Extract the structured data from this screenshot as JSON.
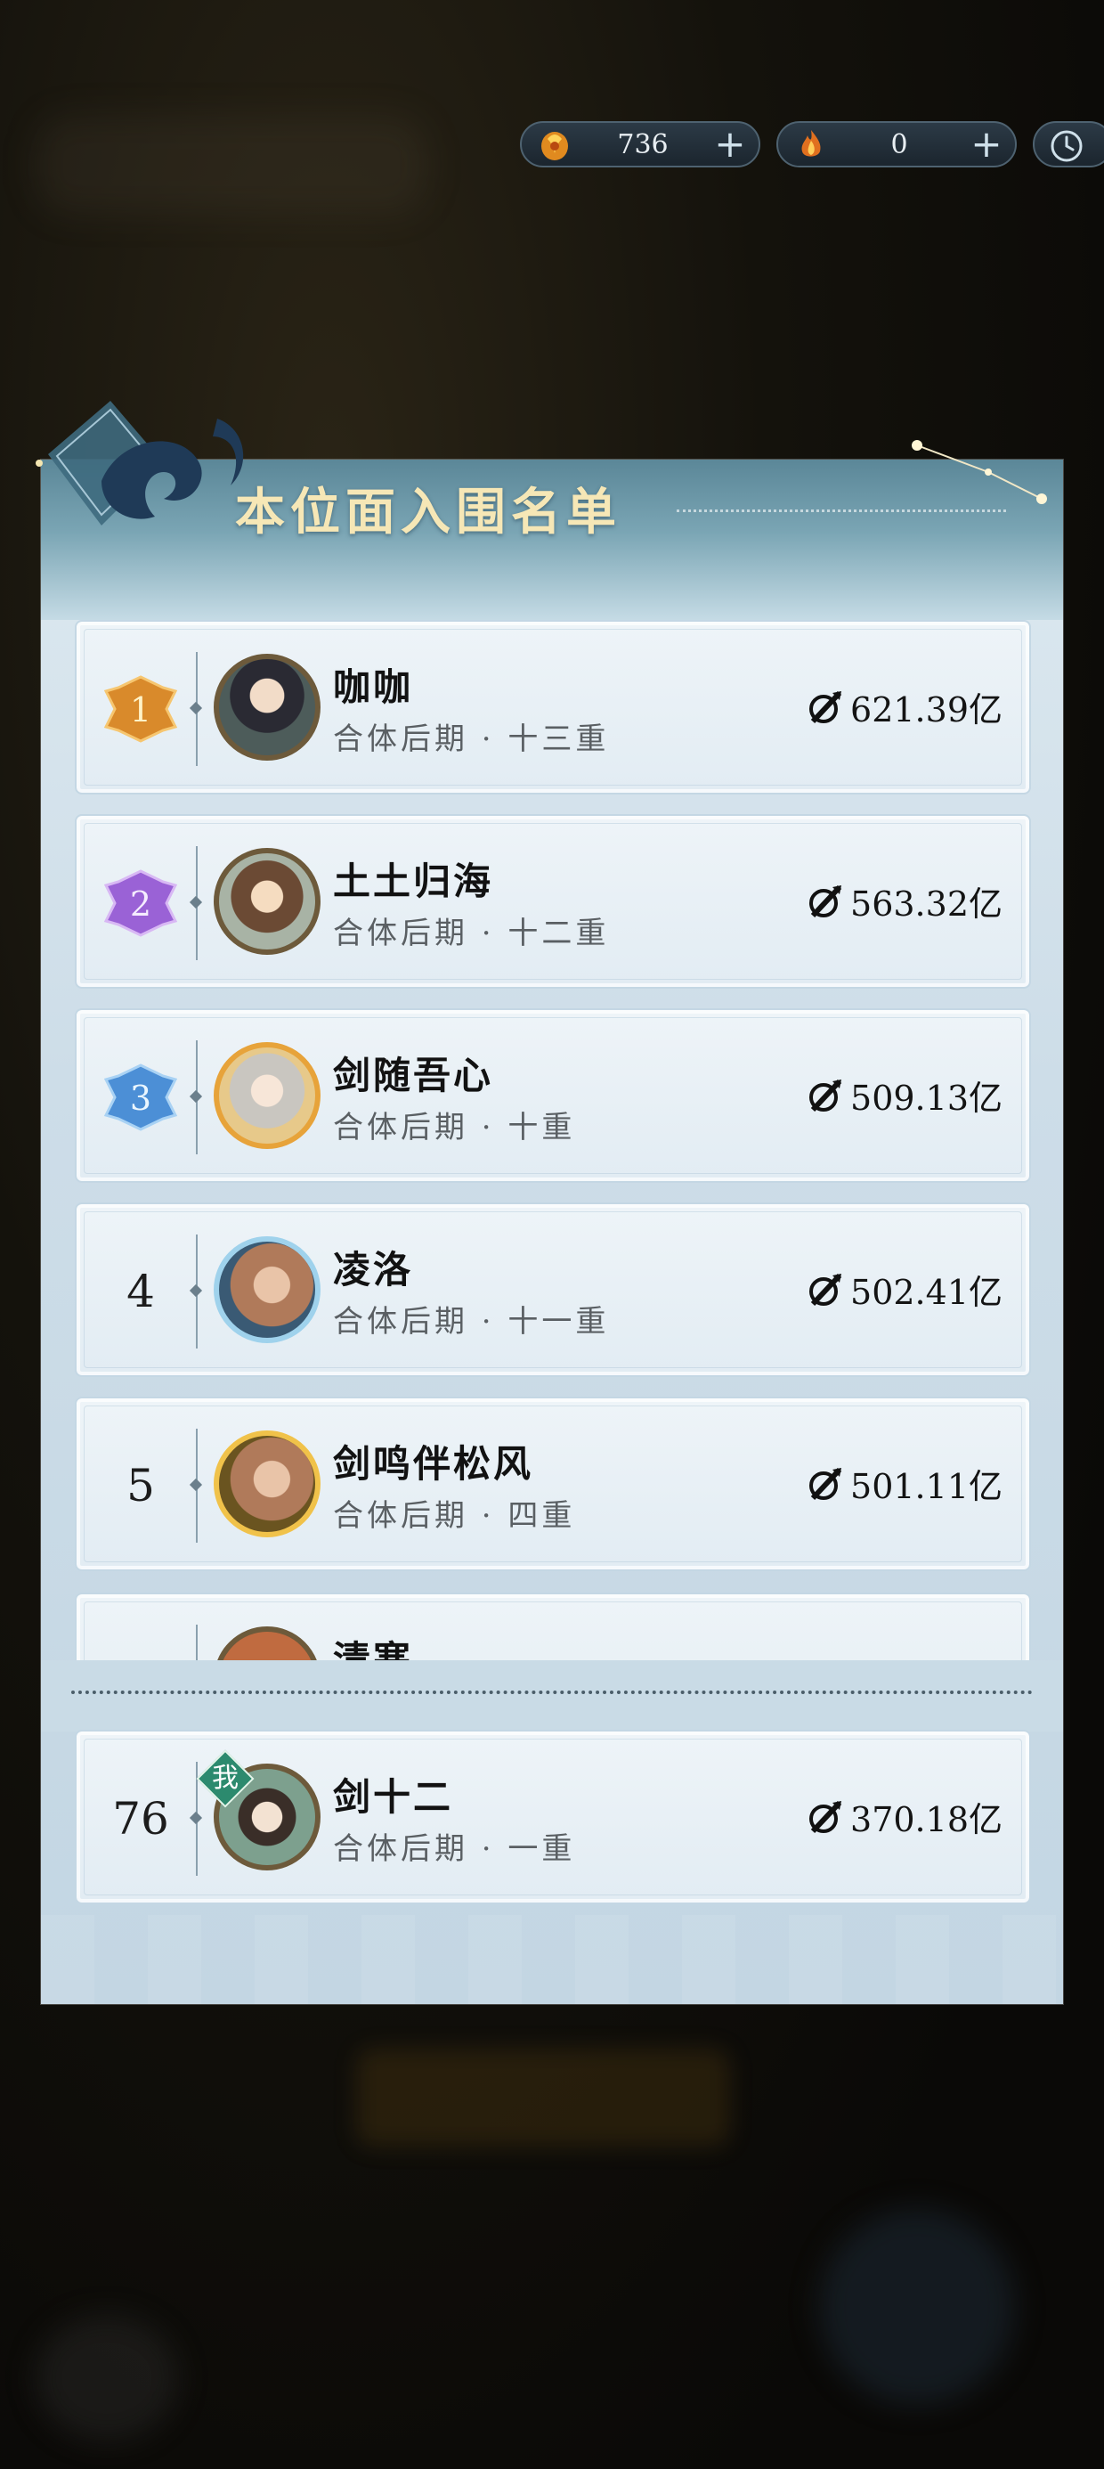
{
  "currency": [
    {
      "icon": "spirit-stone-icon",
      "value": "736"
    },
    {
      "icon": "flame-token-icon",
      "value": "0"
    }
  ],
  "panel": {
    "title": "本位面入围名单"
  },
  "rankings": [
    {
      "rank": "1",
      "name": "咖咖",
      "realm": "合体后期 · 十三重",
      "power": "621.39亿",
      "badge_color": "#d98a2b",
      "frame": "#6d5a3b"
    },
    {
      "rank": "2",
      "name": "土土归海",
      "realm": "合体后期 · 十二重",
      "power": "563.32亿",
      "badge_color": "#9a62d6",
      "frame": "#6d5a3b"
    },
    {
      "rank": "3",
      "name": "剑随吾心",
      "realm": "合体后期 · 十重",
      "power": "509.13亿",
      "badge_color": "#4c8fd6",
      "frame": "#e7a33a"
    },
    {
      "rank": "4",
      "name": "凌洛",
      "realm": "合体后期 · 十一重",
      "power": "502.41亿",
      "frame": "#9fd2ec"
    },
    {
      "rank": "5",
      "name": "剑鸣伴松风",
      "realm": "合体后期 · 四重",
      "power": "501.11亿",
      "frame": "#f0c24a"
    },
    {
      "rank": "",
      "name": "清寒",
      "realm": "",
      "power": ""
    }
  ],
  "me": {
    "rank": "76",
    "tag": "我",
    "name": "剑十二",
    "realm": "合体后期 · 一重",
    "power": "370.18亿"
  }
}
